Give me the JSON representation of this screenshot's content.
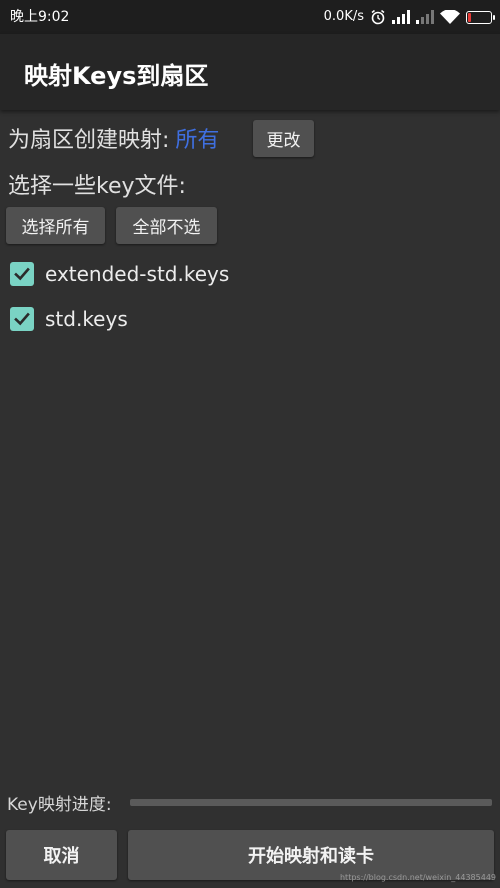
{
  "status_bar": {
    "time": "晚上9:02",
    "network_speed": "0.0K/s",
    "icons": [
      "alarm-icon",
      "signal-icon",
      "signal-icon",
      "wifi-icon",
      "battery-icon"
    ],
    "battery_color": "#e53935",
    "battery_level": 0.15
  },
  "app_bar": {
    "title": "映射Keys到扇区"
  },
  "sector_mapping": {
    "label": "为扇区创建映射:",
    "value": "所有",
    "value_color": "#3f6fe0",
    "change_button": "更改"
  },
  "key_files": {
    "label": "选择一些key文件:",
    "select_all_button": "选择所有",
    "select_none_button": "全部不选",
    "items": [
      {
        "label": "extended-std.keys",
        "checked": true
      },
      {
        "label": "std.keys",
        "checked": true
      }
    ],
    "checkbox_color": "#7ad3c4"
  },
  "progress": {
    "label": "Key映射进度:",
    "value": 0
  },
  "actions": {
    "cancel_button": "取消",
    "start_button": "开始映射和读卡"
  },
  "watermark": "https://blog.csdn.net/weixin_44385449"
}
